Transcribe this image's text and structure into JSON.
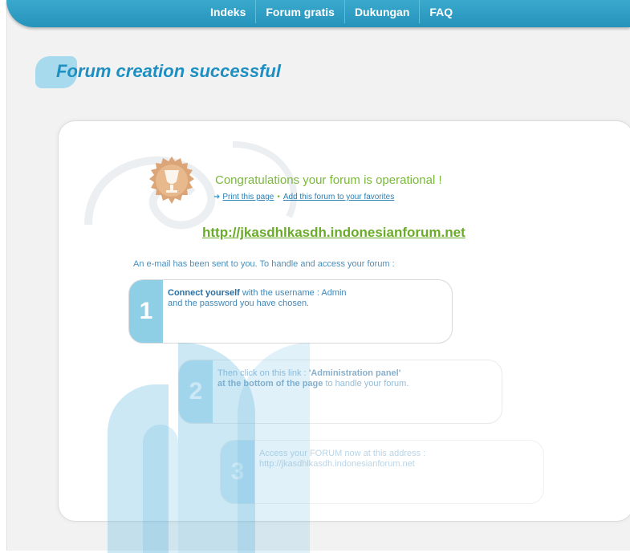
{
  "nav": {
    "tabs": [
      "Indeks",
      "Forum gratis",
      "Dukungan",
      "FAQ"
    ]
  },
  "page": {
    "title": "Forum creation successful"
  },
  "congrats": {
    "message": "Congratulations your forum is operational !",
    "print_link": "Print this page",
    "favorites_link": "Add this forum to your favorites",
    "forum_url": "http://jkasdhlkasdh.indonesianforum.net",
    "email_note": "An e-mail has been sent to you. To handle and access your forum :"
  },
  "steps": [
    {
      "number": "1",
      "bold": "Connect yourself",
      "text_a": " with the username : Admin",
      "text_b": "and the password you have chosen."
    },
    {
      "number": "2",
      "text_a": "Then click on this link : ",
      "bold": "'Administration panel'",
      "bold_b": "at the bottom of the page",
      "text_b": " to handle your forum."
    },
    {
      "number": "3",
      "text_a": "Access your FORUM now at this address :",
      "text_b": "http://jkasdhlkasdh.indonesianforum.net"
    }
  ],
  "colors": {
    "nav": "#2693bb",
    "title": "#1d8fc2",
    "congrats": "#7ab83c",
    "step_number_bg": "#8ecfe6"
  }
}
